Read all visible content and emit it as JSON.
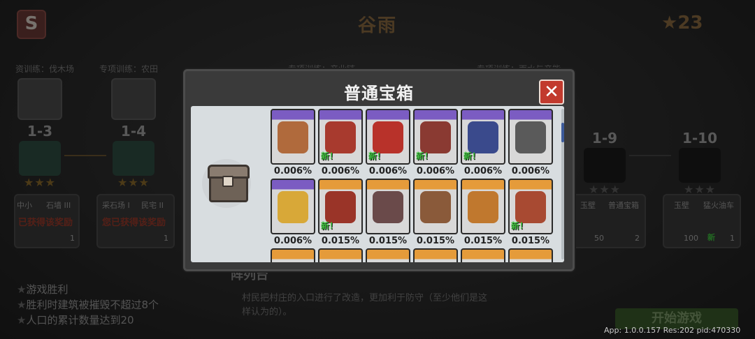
{
  "header": {
    "title": "谷雨",
    "star_count": "23"
  },
  "background": {
    "training_labels": [
      "资训练：伐木场",
      "专项训练：农田",
      "专项训练：产业链",
      "专项训练：雨水与产能"
    ],
    "stages": [
      {
        "num": "1-3",
        "earned": true
      },
      {
        "num": "1-4",
        "earned": true
      },
      {
        "num": "1-9",
        "earned": false
      },
      {
        "num": "1-10",
        "earned": false
      }
    ],
    "rewards": [
      {
        "a": "中小",
        "b": "石墙 III",
        "claimed": "已获得该奖励",
        "count": "1"
      },
      {
        "a": "采石场 I",
        "b": "民宅 II",
        "claimed": "您已获得该奖励",
        "count": "1"
      },
      {
        "a": "玉壁",
        "b": "普通宝箱",
        "count_a": "50",
        "count_b": "2"
      },
      {
        "a": "玉壁",
        "b": "猛火油车",
        "count_a": "100",
        "count_b": "1",
        "new": "新"
      }
    ],
    "area_name": "阵列台",
    "goals": [
      "游戏胜利",
      "胜利时建筑被摧毁不超过8个",
      "人口的累计数量达到20"
    ],
    "description": "村民把村庄的入口进行了改造，更加利于防守（至少他们是这样认为的）。",
    "start_button": "开始游戏",
    "version": "App: 1.0.0.157 Res:202 pid:470330"
  },
  "modal": {
    "title": "普通宝箱",
    "close_icon": "close-icon",
    "new_label": "新！",
    "items": [
      {
        "rarity": "purple",
        "pct": "0.006%",
        "new": false,
        "icon": "armor-piece",
        "color": "#b06a3c"
      },
      {
        "rarity": "purple",
        "pct": "0.006%",
        "new": true,
        "icon": "red-warrior",
        "color": "#a83a2e"
      },
      {
        "rarity": "purple",
        "pct": "0.006%",
        "new": true,
        "icon": "red-hat-hero",
        "color": "#b8322a"
      },
      {
        "rarity": "purple",
        "pct": "0.006%",
        "new": true,
        "icon": "helmet-knight",
        "color": "#8a3a32"
      },
      {
        "rarity": "purple",
        "pct": "0.006%",
        "new": true,
        "icon": "blue-hat-general",
        "color": "#3a4a8c"
      },
      {
        "rarity": "purple",
        "pct": "0.006%",
        "new": false,
        "icon": "robot-tower",
        "color": "#5a5a5a"
      },
      {
        "rarity": "purple",
        "pct": "0.006%",
        "new": false,
        "icon": "golden-totem",
        "color": "#d8a838"
      },
      {
        "rarity": "orange",
        "pct": "0.015%",
        "new": true,
        "icon": "red-soldier",
        "color": "#9a3428"
      },
      {
        "rarity": "orange",
        "pct": "0.015%",
        "new": false,
        "icon": "hooded-brute",
        "color": "#6a4a4a"
      },
      {
        "rarity": "orange",
        "pct": "0.015%",
        "new": false,
        "icon": "catapult",
        "color": "#8a5a3a"
      },
      {
        "rarity": "orange",
        "pct": "0.015%",
        "new": false,
        "icon": "witch-hat",
        "color": "#c0782e"
      },
      {
        "rarity": "orange",
        "pct": "0.015%",
        "new": true,
        "icon": "cannon-cart",
        "color": "#a84a32"
      }
    ]
  }
}
